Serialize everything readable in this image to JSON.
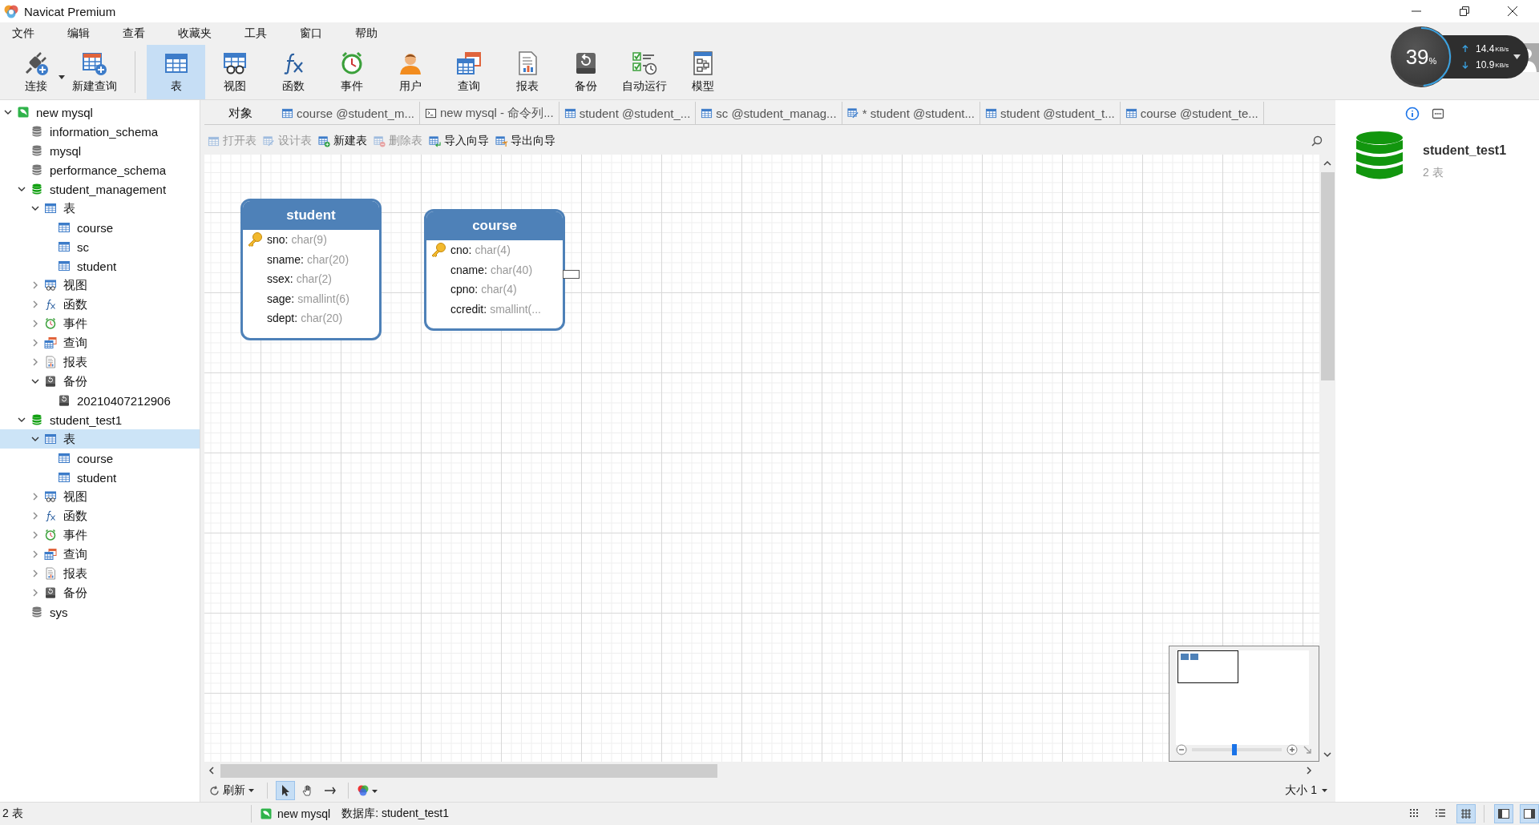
{
  "window": {
    "title": "Navicat Premium"
  },
  "menu": [
    "文件",
    "编辑",
    "查看",
    "收藏夹",
    "工具",
    "窗口",
    "帮助"
  ],
  "toolbar": [
    {
      "label": "连接",
      "kind": "connect",
      "selected": false
    },
    {
      "label": "新建查询",
      "kind": "new_query",
      "selected": false
    },
    {
      "label": "表",
      "kind": "table",
      "selected": true
    },
    {
      "label": "视图",
      "kind": "view",
      "selected": false
    },
    {
      "label": "函数",
      "kind": "function",
      "selected": false
    },
    {
      "label": "事件",
      "kind": "event",
      "selected": false
    },
    {
      "label": "用户",
      "kind": "user",
      "selected": false
    },
    {
      "label": "查询",
      "kind": "query",
      "selected": false
    },
    {
      "label": "报表",
      "kind": "report",
      "selected": false
    },
    {
      "label": "备份",
      "kind": "backup",
      "selected": false
    },
    {
      "label": "自动运行",
      "kind": "automation",
      "selected": false
    },
    {
      "label": "模型",
      "kind": "model",
      "selected": false
    }
  ],
  "net_monitor": {
    "load": "39",
    "load_unit": "%",
    "upload": "14.4",
    "upload_unit": "KB/s",
    "download": "10.9",
    "download_unit": "KB/s"
  },
  "tree": [
    {
      "label": "new mysql",
      "kind": "connection",
      "expanded": true,
      "selected": false,
      "children": [
        {
          "label": "information_schema",
          "kind": "database",
          "connected": false,
          "selected": false
        },
        {
          "label": "mysql",
          "kind": "database",
          "connected": false,
          "selected": false
        },
        {
          "label": "performance_schema",
          "kind": "database",
          "connected": false,
          "selected": false
        },
        {
          "label": "student_management",
          "kind": "database",
          "connected": true,
          "expanded": true,
          "selected": false,
          "children": [
            {
              "label": "表",
              "kind": "table",
              "expanded": true,
              "selected": false,
              "children": [
                {
                  "label": "course",
                  "kind": "table",
                  "selected": false
                },
                {
                  "label": "sc",
                  "kind": "table",
                  "selected": false
                },
                {
                  "label": "student",
                  "kind": "table",
                  "selected": false
                }
              ]
            },
            {
              "label": "视图",
              "kind": "view",
              "expanded": false,
              "selected": false
            },
            {
              "label": "函数",
              "kind": "function",
              "expanded": false,
              "selected": false
            },
            {
              "label": "事件",
              "kind": "event",
              "expanded": false,
              "selected": false
            },
            {
              "label": "查询",
              "kind": "query",
              "expanded": false,
              "selected": false
            },
            {
              "label": "报表",
              "kind": "report",
              "expanded": false,
              "selected": false
            },
            {
              "label": "备份",
              "kind": "backup",
              "expanded": true,
              "selected": false,
              "children": [
                {
                  "label": "20210407212906",
                  "kind": "backup",
                  "selected": false
                }
              ]
            }
          ]
        },
        {
          "label": "student_test1",
          "kind": "database",
          "connected": true,
          "expanded": true,
          "selected": false,
          "children": [
            {
              "label": "表",
              "kind": "table",
              "expanded": true,
              "selected": true,
              "children": [
                {
                  "label": "course",
                  "kind": "table",
                  "selected": false
                },
                {
                  "label": "student",
                  "kind": "table",
                  "selected": false
                }
              ]
            },
            {
              "label": "视图",
              "kind": "view",
              "expanded": false,
              "selected": false
            },
            {
              "label": "函数",
              "kind": "function",
              "expanded": false,
              "selected": false
            },
            {
              "label": "事件",
              "kind": "event",
              "expanded": false,
              "selected": false
            },
            {
              "label": "查询",
              "kind": "query",
              "expanded": false,
              "selected": false
            },
            {
              "label": "报表",
              "kind": "report",
              "expanded": false,
              "selected": false
            },
            {
              "label": "备份",
              "kind": "backup",
              "expanded": false,
              "selected": false
            }
          ]
        },
        {
          "label": "sys",
          "kind": "database",
          "connected": false,
          "selected": false
        }
      ]
    }
  ],
  "tabs": [
    {
      "label": "对象",
      "kind": "objects",
      "selected": true
    },
    {
      "label": "course @student_m...",
      "kind": "table",
      "selected": false
    },
    {
      "label": "new mysql - 命令列...",
      "kind": "console",
      "selected": false
    },
    {
      "label": "student @student_...",
      "kind": "table",
      "selected": false
    },
    {
      "label": "sc @student_manag...",
      "kind": "table",
      "selected": false
    },
    {
      "label": "* student @student...",
      "kind": "design",
      "selected": false
    },
    {
      "label": "student @student_t...",
      "kind": "table",
      "selected": false
    },
    {
      "label": "course @student_te...",
      "kind": "table",
      "selected": false
    }
  ],
  "object_actions": [
    {
      "label": "打开表",
      "kind": "open",
      "disabled": true
    },
    {
      "label": "设计表",
      "kind": "design",
      "disabled": true
    },
    {
      "label": "新建表",
      "kind": "new",
      "disabled": false
    },
    {
      "label": "删除表",
      "kind": "delete",
      "disabled": true
    },
    {
      "label": "导入向导",
      "kind": "import",
      "disabled": false
    },
    {
      "label": "导出向导",
      "kind": "export",
      "disabled": false
    }
  ],
  "diagram": {
    "entities": [
      {
        "name": "student",
        "fields": [
          {
            "name": "sno:",
            "type": "char(9)",
            "primary_key": true
          },
          {
            "name": "sname:",
            "type": "char(20)",
            "primary_key": false
          },
          {
            "name": "ssex:",
            "type": "char(2)",
            "primary_key": false
          },
          {
            "name": "sage:",
            "type": "smallint(6)",
            "primary_key": false
          },
          {
            "name": "sdept:",
            "type": "char(20)",
            "primary_key": false
          }
        ]
      },
      {
        "name": "course",
        "fields": [
          {
            "name": "cno:",
            "type": "char(4)",
            "primary_key": true
          },
          {
            "name": "cname:",
            "type": "char(40)",
            "primary_key": false
          },
          {
            "name": "cpno:",
            "type": "char(4)",
            "primary_key": false
          },
          {
            "name": "ccredit:",
            "type": "smallint(...",
            "primary_key": false
          }
        ]
      }
    ]
  },
  "minimap": {
    "level": 0.47
  },
  "bottom_toolbar": {
    "refresh": "刷新",
    "tools": [
      {
        "kind": "pointer",
        "selected": true
      },
      {
        "kind": "hand",
        "selected": false
      },
      {
        "kind": "connector",
        "selected": false
      }
    ],
    "zoom_label": "大小 1"
  },
  "info_panel": {
    "tabs": [
      {
        "kind": "info",
        "selected": true
      },
      {
        "kind": "ddl",
        "selected": false
      }
    ],
    "name": "student_test1",
    "detail": "2 表"
  },
  "status_bar": {
    "count": "2 表",
    "connection": "new mysql",
    "database": "数据库: student_test1",
    "views": [
      {
        "kind": "grid",
        "selected": false
      },
      {
        "kind": "list",
        "selected": false
      },
      {
        "kind": "er",
        "selected": true
      }
    ],
    "panels": [
      {
        "kind": "left",
        "selected": true
      },
      {
        "kind": "right",
        "selected": true
      }
    ]
  }
}
